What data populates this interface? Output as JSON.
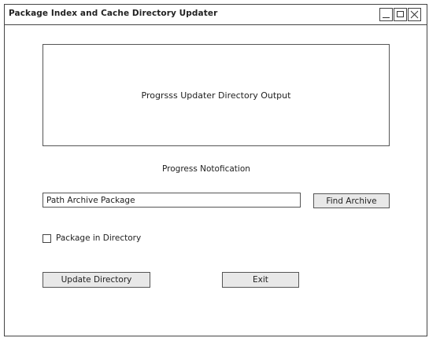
{
  "window": {
    "title": "Package Index and Cache Directory Updater",
    "controls": {
      "minimize": "minimize-icon",
      "maximize": "maximize-icon",
      "close": "close-icon"
    }
  },
  "main": {
    "output_label": "Progrsss Updater Directory Output",
    "progress_label": "Progress Notofication",
    "path_input_value": "Path Archive Package",
    "find_button_label": "Find Archive",
    "checkbox_label": "Package in Directory",
    "checkbox_checked": false,
    "update_button_label": "Update Directory",
    "exit_button_label": "Exit"
  }
}
